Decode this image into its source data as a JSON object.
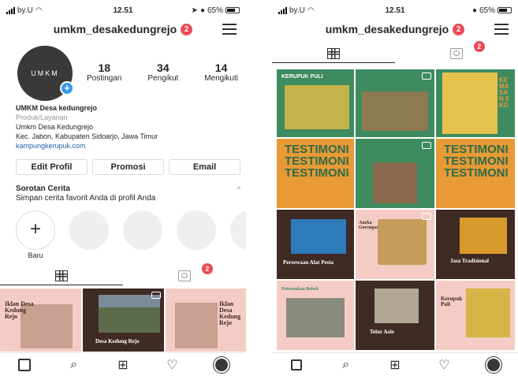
{
  "status": {
    "carrier": "by.U",
    "time": "12.51",
    "battery": "65%"
  },
  "profile": {
    "username": "umkm_desakedungrejo",
    "notifications": "2",
    "avatar_text": "UMKM",
    "stats": [
      {
        "value": "18",
        "label": "Postingan"
      },
      {
        "value": "34",
        "label": "Pengikut"
      },
      {
        "value": "14",
        "label": "Mengikuti"
      }
    ],
    "bio": {
      "name": "UMKM Desa kedungrejo",
      "category": "Produk/Layanan",
      "line1": "Umkm Desa Kedungrejo",
      "line2": "Kec. Jabon, Kabupaten Sidoarjo, Jawa Timur",
      "link": "kampungkerupuk.com"
    },
    "buttons": {
      "edit": "Edit Profil",
      "promo": "Promosi",
      "email": "Email"
    },
    "stories": {
      "title": "Sorotan Cerita",
      "subtitle": "Simpan cerita favorit Anda di profil Anda",
      "new_label": "Baru",
      "new_symbol": "+"
    },
    "tag_badge": "2"
  },
  "left_posts": [
    {
      "text": "Iklan Desa Kedung Rejo"
    },
    {
      "text": "Desa Kedung Rejo"
    },
    {
      "text": "Iklan Desa Kedung Rejo"
    }
  ],
  "right_posts": {
    "r1": [
      "KERUPUK PULI",
      "",
      ""
    ],
    "r1_side": "KEMASAN 5KG",
    "testimoni": "TESTIMONI TESTIMONI TESTIMONI",
    "r3": [
      "Persewaan Alat Pesta",
      "Aneka Gorengan",
      "Jasa Tradisional"
    ],
    "r4": [
      "Peternakan Bebek",
      "Telur Asin",
      "Kerupuk Puli"
    ]
  },
  "nav": {
    "search": "⌕",
    "add": "⊞",
    "heart": "♡"
  },
  "colors": {
    "accent": "#ed4956",
    "link": "#2f5fa8",
    "pink": "#f4ccc5",
    "green": "#3e8b5f",
    "orange": "#e79a36",
    "brown": "#3f2a24"
  }
}
